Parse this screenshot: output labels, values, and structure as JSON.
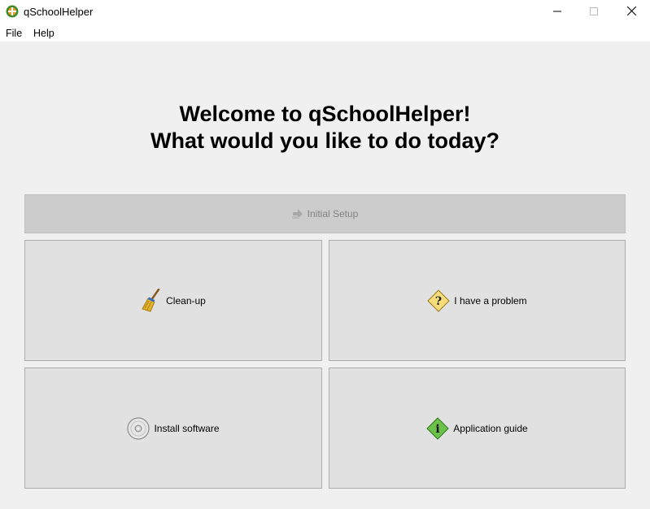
{
  "window": {
    "title": "qSchoolHelper",
    "icons": {
      "app": "app-logo-icon",
      "minimize": "minimize-icon",
      "maximize": "maximize-icon",
      "close": "close-icon"
    }
  },
  "menu": {
    "file": "File",
    "help": "Help"
  },
  "welcome": {
    "line1": "Welcome to qSchoolHelper!",
    "line2": "What would you like to do today?"
  },
  "buttons": {
    "initial_setup": {
      "label": "Initial Setup",
      "icon": "arrow-right-icon",
      "enabled": false
    },
    "cleanup": {
      "label": "Clean-up",
      "icon": "broom-icon"
    },
    "problem": {
      "label": "I have a problem",
      "icon": "question-diamond-icon"
    },
    "install": {
      "label": "Install software",
      "icon": "cd-disc-icon"
    },
    "guide": {
      "label": "Application guide",
      "icon": "info-diamond-icon"
    }
  },
  "colors": {
    "window_bg": "#f0f0f0",
    "button_bg": "#e1e1e1",
    "disabled_bg": "#cccccc",
    "disabled_text": "#838383"
  }
}
